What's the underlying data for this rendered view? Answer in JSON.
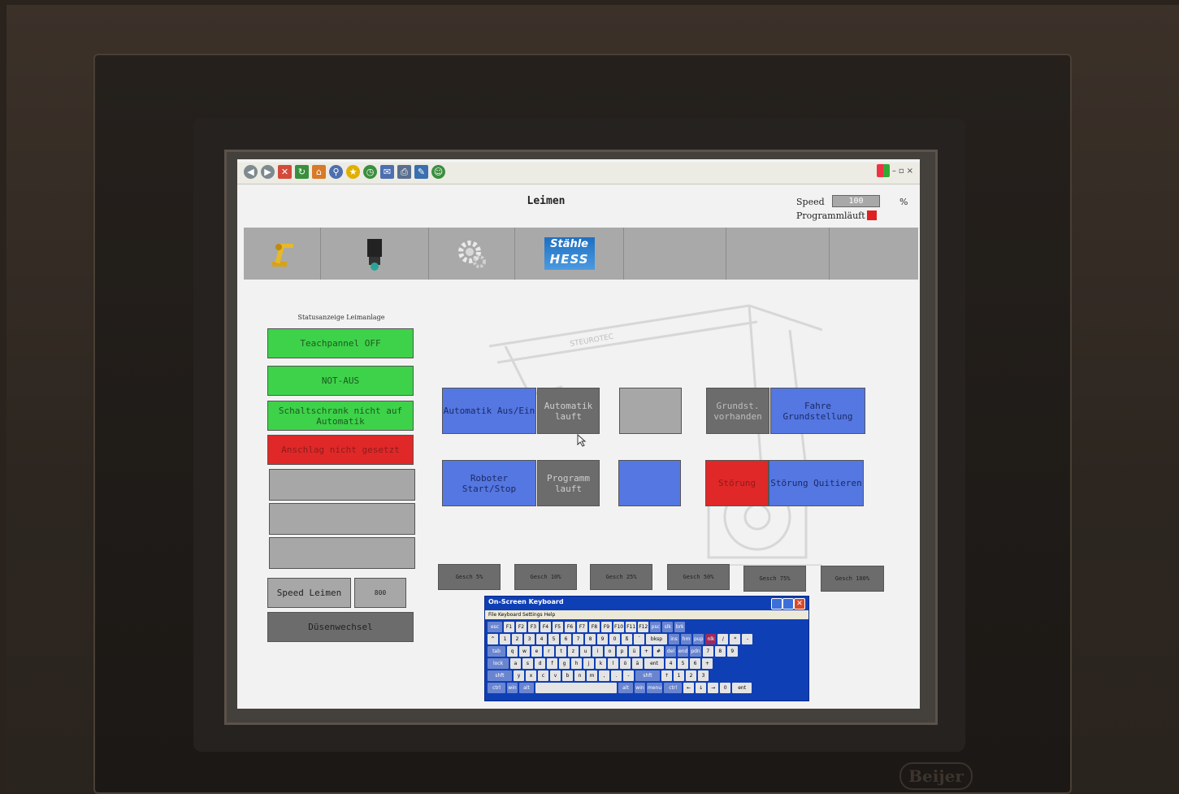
{
  "ie_toolbar": {
    "icons": [
      "back-icon",
      "forward-icon",
      "stop-icon",
      "refresh-icon",
      "home-icon",
      "search-icon",
      "favorites-icon",
      "history-icon",
      "mail-icon",
      "print-icon",
      "edit-icon",
      "messenger-icon"
    ]
  },
  "header": {
    "title": "Leimen",
    "speed_label": "Speed",
    "speed_value": "100",
    "speed_unit": "%",
    "program_label": "Programmläuft"
  },
  "nav": {
    "items": [
      "robot-icon",
      "camera-icon",
      "settings-gear-icon",
      "stahle-hess-logo",
      "",
      "",
      ""
    ],
    "logo_line1": "Stähle",
    "logo_line2": "HESS"
  },
  "status": {
    "caption": "Statusanzeige Leimanlage",
    "items": [
      "Teachpannel OFF",
      "NOT-AUS",
      "Schaltschrank nicht auf Automatik",
      "Anschlag nicht gesetzt",
      "",
      "",
      ""
    ],
    "speed_button": "Speed Leimen",
    "speed_value": "800",
    "nozzle_button": "Düsenwechsel"
  },
  "controls": {
    "auto_toggle": "Automatik Aus/Ein",
    "auto_running": "Automatik lauft",
    "home_available": "Grundst. vorhanden",
    "go_home": "Fahre Grundstellung",
    "robot_start": "Roboter Start/Stop",
    "program_running": "Programm lauft",
    "fault": "Störung",
    "ack_fault": "Störung Quitieren"
  },
  "speeds": [
    "Gesch 5%",
    "Gesch 10%",
    "Gesch 25%",
    "Gesch 50%",
    "Gesch 75%",
    "Gesch 100%"
  ],
  "watermark": "STEUROTEC",
  "osk": {
    "title": "On-Screen Keyboard",
    "menu": "File   Keyboard   Settings   Help",
    "row1": [
      "esc",
      "F1",
      "F2",
      "F3",
      "F4",
      "F5",
      "F6",
      "F7",
      "F8",
      "F9",
      "F10",
      "F11",
      "F12",
      "psc",
      "slk",
      "brk"
    ],
    "row2": [
      "^",
      "1",
      "2",
      "3",
      "4",
      "5",
      "6",
      "7",
      "8",
      "9",
      "0",
      "ß",
      "´",
      "bksp",
      "ins",
      "hm",
      "pup",
      "nlk",
      "/",
      "*",
      "-"
    ],
    "row3": [
      "tab",
      "q",
      "w",
      "e",
      "r",
      "t",
      "z",
      "u",
      "i",
      "o",
      "p",
      "ü",
      "+",
      "#",
      "del",
      "end",
      "pdn",
      "7",
      "8",
      "9"
    ],
    "row4": [
      "lock",
      "a",
      "s",
      "d",
      "f",
      "g",
      "h",
      "j",
      "k",
      "l",
      "ö",
      "ä",
      "ent",
      "4",
      "5",
      "6",
      "+"
    ],
    "row5": [
      "shft",
      "y",
      "x",
      "c",
      "v",
      "b",
      "n",
      "m",
      ",",
      ".",
      "-",
      "shft",
      "↑",
      "1",
      "2",
      "3"
    ],
    "row6": [
      "ctrl",
      "win",
      "alt",
      "",
      "alt",
      "win",
      "menu",
      "ctrl",
      "←",
      "↓",
      "→",
      "0",
      "ent"
    ]
  },
  "bezel_brand": "Beijer",
  "colors": {
    "green": "#3ed24a",
    "red": "#e02828",
    "blue": "#5577e2",
    "grey": "#a7a7a7",
    "dark_grey": "#6c6c6c"
  }
}
